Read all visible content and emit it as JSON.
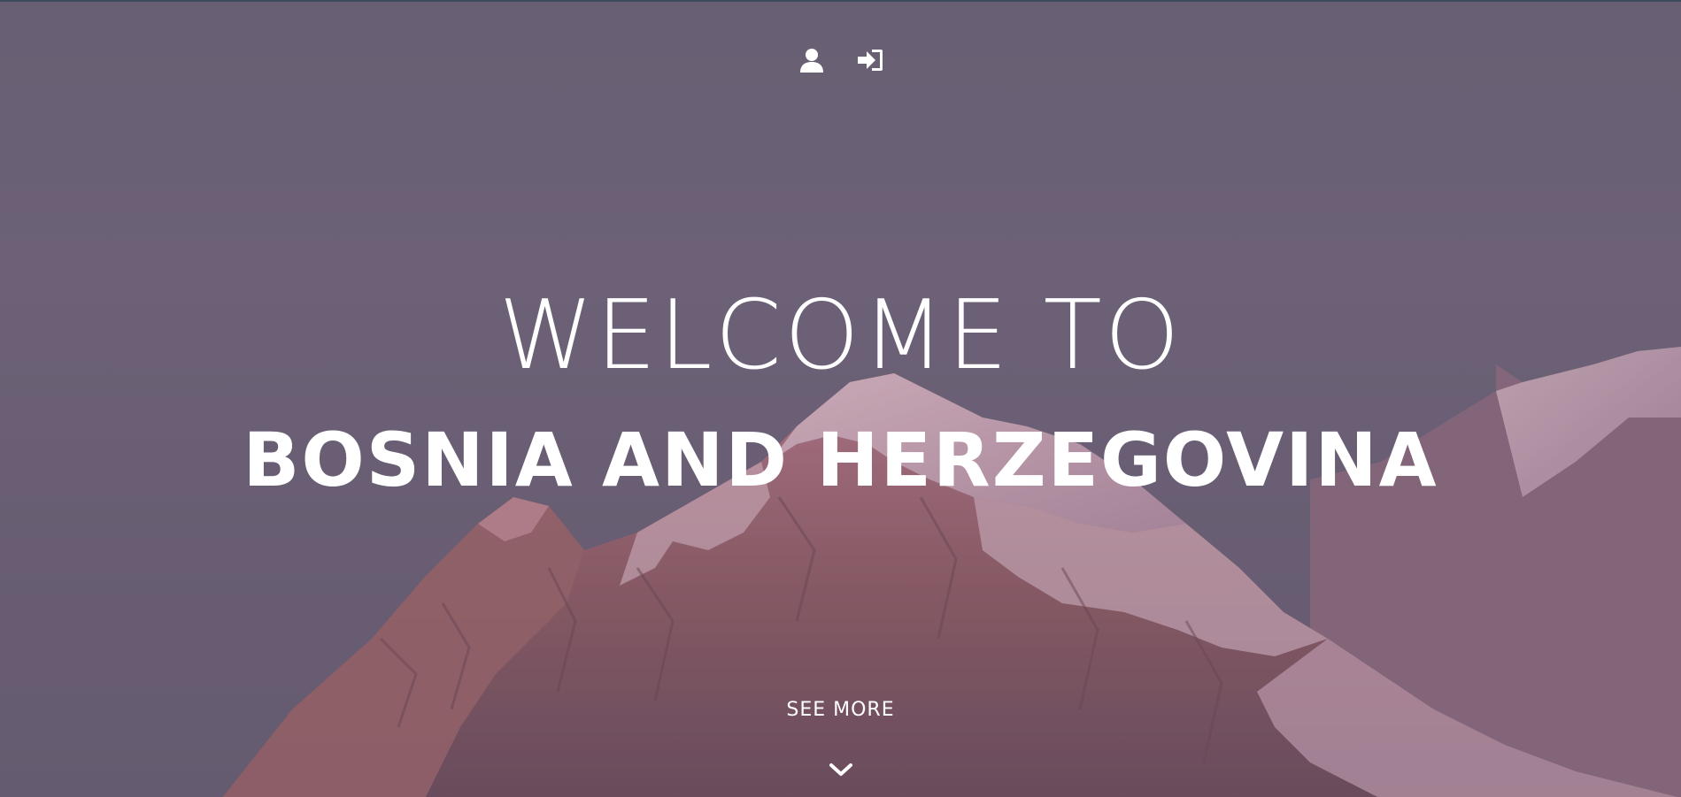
{
  "header": {
    "icons": [
      {
        "name": "user-icon"
      },
      {
        "name": "sign-in-icon"
      }
    ]
  },
  "hero": {
    "line1": "WELCOME TO",
    "line2": "BOSNIA AND HERZEGOVINA",
    "see_more_label": "SEE MORE",
    "scroll_icon": "chevron-down-icon",
    "background_image": "snow-capped mountain peaks at dusk"
  },
  "colors": {
    "text": "#ffffff",
    "sky": "#6c6276",
    "rock": "#8a5a5a",
    "snow": "#d9b8c4"
  }
}
